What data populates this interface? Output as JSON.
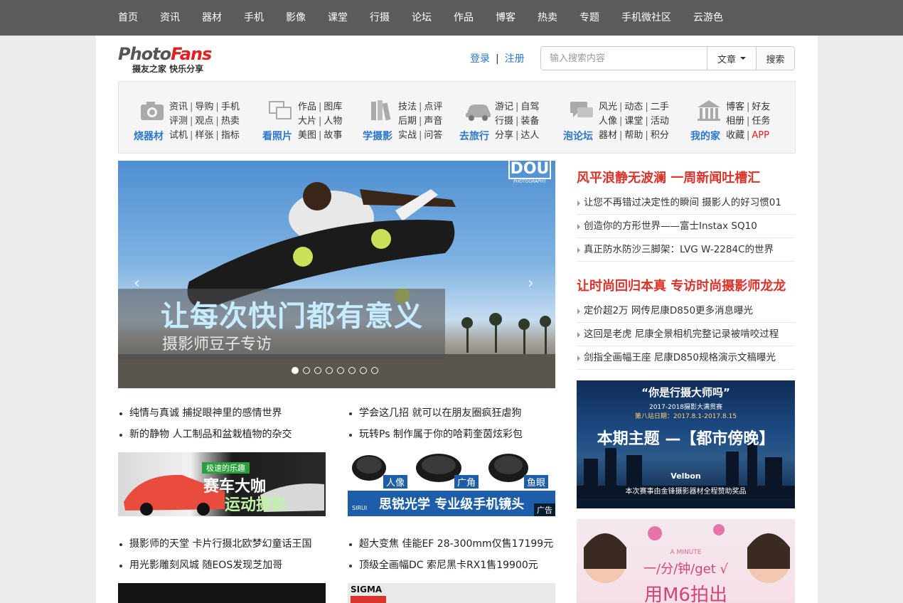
{
  "topnav": [
    "首页",
    "资讯",
    "器材",
    "手机",
    "影像",
    "课堂",
    "行摄",
    "论坛",
    "作品",
    "博客",
    "热卖",
    "专题",
    "手机微社区",
    "云游色"
  ],
  "logo": {
    "word_a": "Photo",
    "word_b": "Fans",
    "slogan": "摄友之家 快乐分享"
  },
  "auth": {
    "login": "登录",
    "separator": "|",
    "register": "注册"
  },
  "search": {
    "placeholder": "输入搜索内容",
    "type": "文章",
    "button": "搜索"
  },
  "categories": [
    {
      "title": "烧器材",
      "icon": "camera-icon",
      "rows": [
        [
          "资讯",
          "导购",
          "手机"
        ],
        [
          "评测",
          "观点",
          "热卖"
        ],
        [
          "试机",
          "样张",
          "指标"
        ]
      ]
    },
    {
      "title": "看照片",
      "icon": "photos-icon",
      "rows": [
        [
          "作品",
          "图库"
        ],
        [
          "大片",
          "人物"
        ],
        [
          "美图",
          "故事"
        ]
      ]
    },
    {
      "title": "学摄影",
      "icon": "books-icon",
      "rows": [
        [
          "技法",
          "点评"
        ],
        [
          "后期",
          "声音"
        ],
        [
          "实战",
          "问答"
        ]
      ]
    },
    {
      "title": "去旅行",
      "icon": "car-icon",
      "rows": [
        [
          "游记",
          "自驾"
        ],
        [
          "行摄",
          "装备"
        ],
        [
          "分享",
          "达人"
        ]
      ]
    },
    {
      "title": "泡论坛",
      "icon": "chat-icon",
      "rows": [
        [
          "风光",
          "动态",
          "二手"
        ],
        [
          "人像",
          "课堂",
          "活动"
        ],
        [
          "器材",
          "帮助",
          "积分"
        ]
      ]
    },
    {
      "title": "我的家",
      "icon": "home-icon",
      "rows": [
        [
          "博客",
          "好友"
        ],
        [
          "相册",
          "任务"
        ],
        [
          "收藏",
          "APP"
        ]
      ]
    }
  ],
  "slider": {
    "caption": "让每次快门都有意义",
    "subcaption": "摄影师豆子专访",
    "brand": "DOU",
    "brand_sub": "PHOTOGRAPHY",
    "prev": "‹",
    "next": "›",
    "dot_count": 8,
    "active_dot": 0
  },
  "left_news_1": [
    "纯情与真诚 捕捉眼神里的感情世界",
    "新的静物 人工制品和盆栽植物的杂交"
  ],
  "mid_news_1": [
    "学会这几招 就可以在朋友圈疯狂虐狗",
    "玩转Ps 制作属于你的哈莉奎茵炫彩包"
  ],
  "left_news_2": [
    "摄影师的天堂 卡片行摄北欧梦幻童话王国",
    "用光影雕刻风城 随EOS发现芝加哥"
  ],
  "mid_news_2": [
    "超大变焦 佳能EF 28-300mm仅售17199元",
    "顶级全画幅DC 索尼黑卡RX1售19900元"
  ],
  "banner_race": {
    "line1": "赛车大咖",
    "line2": "运动摄影",
    "tag": "极速的乐趣"
  },
  "banner_sirui": {
    "labels": [
      "人像",
      "广角",
      "鱼眼"
    ],
    "brand": "SIRUI",
    "slogan": "思锐光学  专业级手机镜头",
    "ad": "广告"
  },
  "banner_sigma": {
    "brand": "SIGMA"
  },
  "right": {
    "headline1": "风平浪静无波澜 一周新闻吐槽汇",
    "list1": [
      "让您不再错过决定性的瞬间 摄影人的好习惯01",
      "创造你的方形世界——富士Instax SQ10",
      "真正防水防沙三脚架：LVG W-2284C的世界"
    ],
    "headline2": "让时尚回归本真 专访时尚摄影师龙龙",
    "list2": [
      "定价超2万 网传尼康D850更多消息曝光",
      "这回是老虎 尼康全景相机完整记录被啃咬过程",
      "剑指全画幅王座 尼康D850规格演示文稿曝光"
    ],
    "promo1": {
      "title": "“你是行摄大师吗”",
      "sub": "2017-2018摄影大满贯赛",
      "dates": "第八站日期：2017.8.1-2017.8.15",
      "theme": "本期主题 —【都市傍晚】",
      "sponsor": "Velbon",
      "footer": "本次赛事由金锋摄影器材全程赞助奖品"
    },
    "promo2": {
      "tag": "A MINUTE",
      "line1": "一/分/钟/get √",
      "line2": "用M6拍出"
    }
  }
}
